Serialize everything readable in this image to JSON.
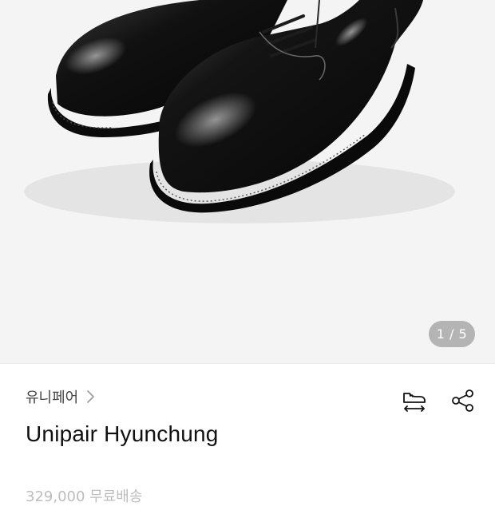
{
  "gallery": {
    "page_indicator": "1 / 5",
    "background": "#f4f4f4",
    "image": "black-leather-derby-shoes"
  },
  "brand": {
    "name": "유니페어",
    "icon": "chevron-right-icon"
  },
  "actions": {
    "size_icon": "shoe-size-icon",
    "share_icon": "share-icon"
  },
  "product": {
    "name": "Unipair Hyunchung"
  },
  "price_row": {
    "text": "329,000 무료배송"
  }
}
